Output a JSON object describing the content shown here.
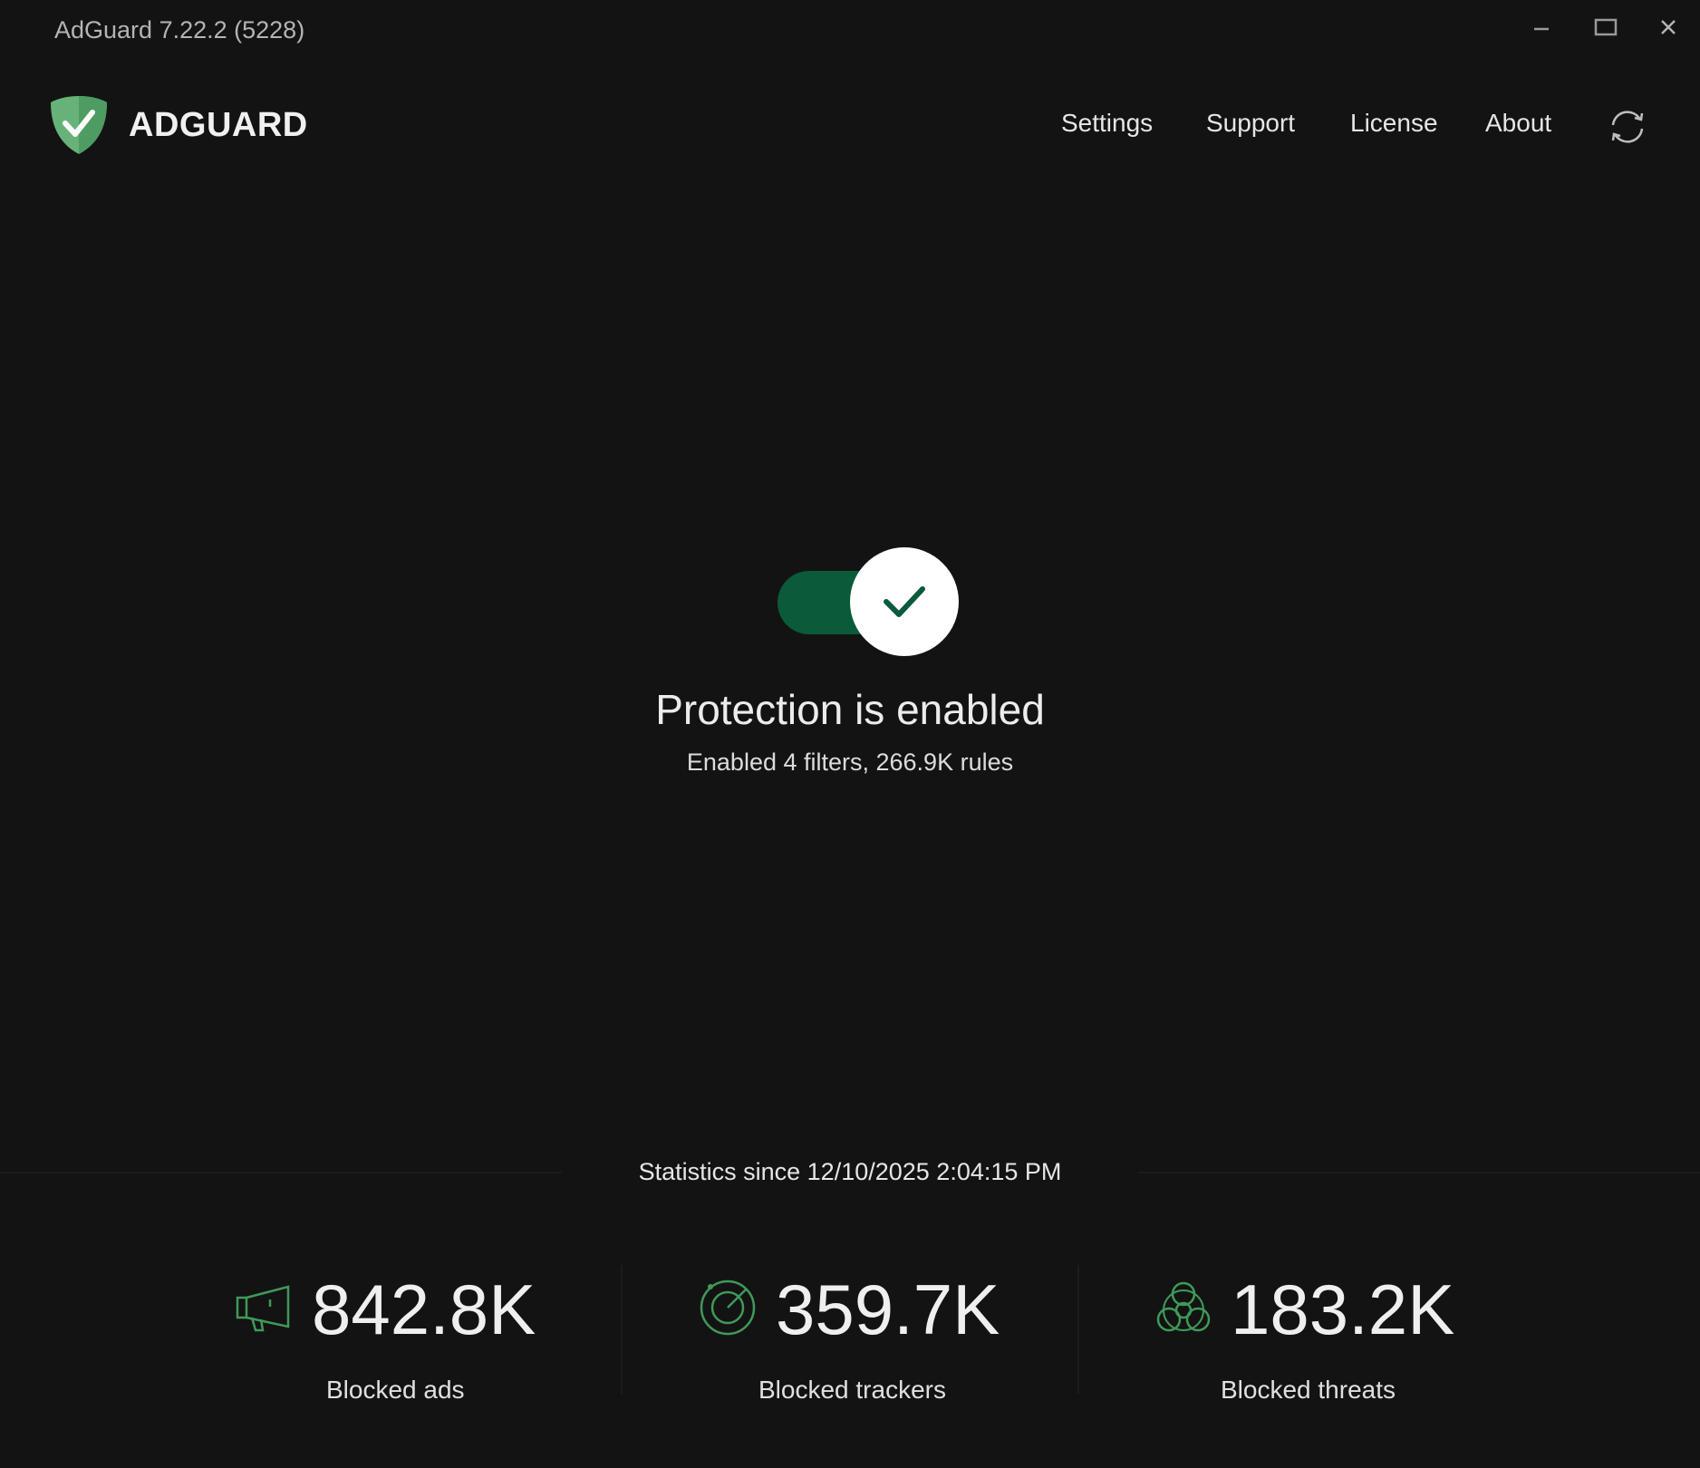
{
  "window": {
    "title": "AdGuard 7.22.2 (5228)",
    "controls": [
      "minimize-icon",
      "maximize-icon",
      "close-icon"
    ]
  },
  "header": {
    "brand": "ADGUARD",
    "nav": {
      "settings": "Settings",
      "support": "Support",
      "license": "License",
      "about": "About"
    },
    "refresh_icon": "refresh-icon"
  },
  "protection": {
    "enabled": true,
    "title": "Protection is enabled",
    "subtitle": "Enabled 4 filters, 266.9K rules"
  },
  "statistics": {
    "since": "Statistics since 12/10/2025 2:04:15 PM",
    "items": [
      {
        "icon": "megaphone-icon",
        "value": "842.8K",
        "label": "Blocked ads"
      },
      {
        "icon": "radar-icon",
        "value": "359.7K",
        "label": "Blocked trackers"
      },
      {
        "icon": "biohazard-icon",
        "value": "183.2K",
        "label": "Blocked threats"
      }
    ]
  },
  "colors": {
    "background": "#131313",
    "accent_green": "#67b279",
    "toggle_track": "#0b5a3a",
    "check_color": "#0b5a3a"
  }
}
